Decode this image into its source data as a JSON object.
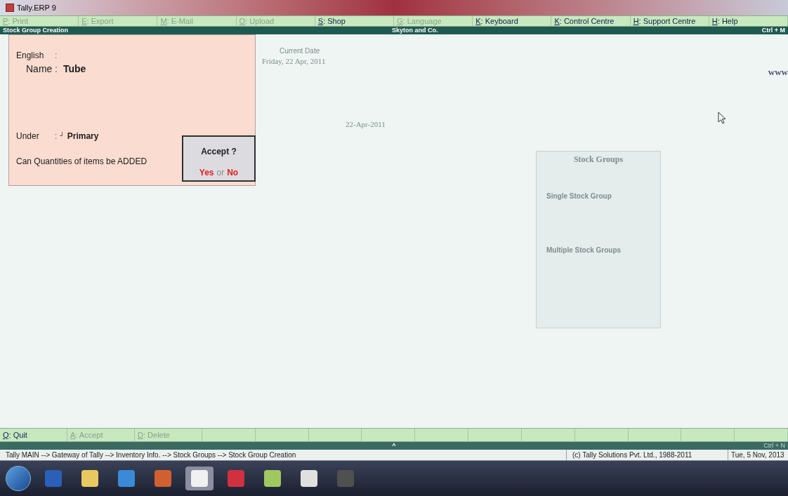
{
  "window": {
    "title": "Tally.ERP 9"
  },
  "menu": [
    {
      "text": "P: Print",
      "disabled": true
    },
    {
      "text": "E: Export",
      "disabled": true
    },
    {
      "text": "M: E-Mail",
      "disabled": true
    },
    {
      "text": "O: Upload",
      "disabled": true
    },
    {
      "text": "S: Shop",
      "disabled": false
    },
    {
      "text": "G: Language",
      "disabled": true
    },
    {
      "text": "K: Keyboard",
      "disabled": false
    },
    {
      "text": "K: Control Centre",
      "disabled": false
    },
    {
      "text": "H: Support Centre",
      "disabled": false
    },
    {
      "text": "H: Help",
      "disabled": false
    }
  ],
  "header": {
    "screen": "Stock Group Creation",
    "company": "Skyton and Co.",
    "shortcut": "Ctrl + M"
  },
  "form": {
    "fields": [
      {
        "label": "English",
        "separator": ":"
      },
      {
        "label": "Name",
        "separator": ":",
        "value": "Tube"
      }
    ],
    "under": {
      "label": "Under",
      "separator": ":",
      "marker": "┘",
      "value": "Primary"
    },
    "question": "Can Quantities of items be ADDED"
  },
  "dialog": {
    "title": "Accept ?",
    "yes": "Yes",
    "or": "or",
    "no": "No"
  },
  "background": {
    "current_date_label": "Current Date",
    "current_date": "Friday, 22 Apr, 2011",
    "last_entry_date": "22-Apr-2011",
    "menu_title": "Stock Groups",
    "sections": [
      {
        "title": "Single Stock Group"
      },
      {
        "title": "Multiple Stock Groups"
      }
    ],
    "website": "www"
  },
  "buttons": [
    {
      "text": "Q: Quit",
      "disabled": false
    },
    {
      "text": "A: Accept",
      "disabled": true
    },
    {
      "text": "D: Delete",
      "disabled": true
    }
  ],
  "bottom_strip": {
    "caret": "^",
    "shortcut": "Ctrl + N"
  },
  "status_bar": {
    "path": "Tally MAIN --> Gateway of Tally --> Inventory Info. --> Stock Groups --> Stock Group Creation",
    "copyright": "(c) Tally Solutions Pvt. Ltd., 1988-2011",
    "date": "Tue, 5 Nov, 2013"
  }
}
